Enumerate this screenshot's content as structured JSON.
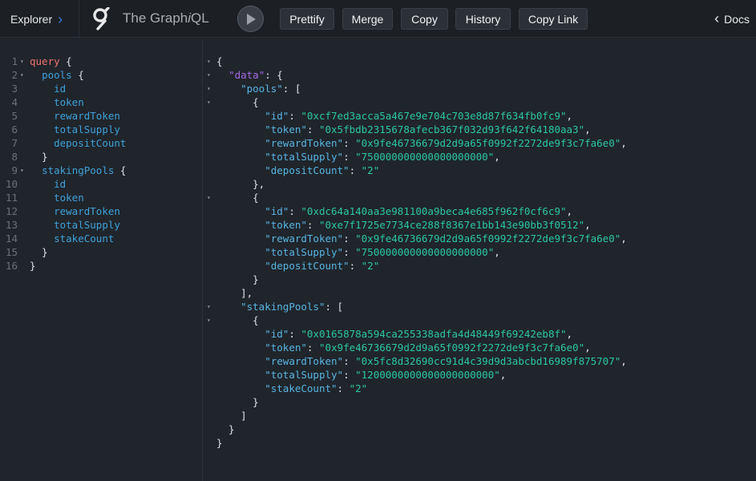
{
  "topbar": {
    "explorer_label": "Explorer",
    "title_prefix": "The Graph",
    "title_italic": "i",
    "title_suffix": "QL",
    "buttons": [
      "Prettify",
      "Merge",
      "Copy",
      "History",
      "Copy Link"
    ],
    "docs_label": "Docs"
  },
  "query_lines": [
    {
      "n": "1",
      "t": [
        [
          "kw",
          "query"
        ],
        [
          "pun",
          " {"
        ]
      ],
      "fold": true
    },
    {
      "n": "2",
      "t": [
        [
          "pun",
          "  "
        ],
        [
          "fld",
          "pools"
        ],
        [
          "pun",
          " {"
        ]
      ],
      "fold": true
    },
    {
      "n": "3",
      "t": [
        [
          "pun",
          "    "
        ],
        [
          "fld",
          "id"
        ]
      ]
    },
    {
      "n": "4",
      "t": [
        [
          "pun",
          "    "
        ],
        [
          "fld",
          "token"
        ]
      ]
    },
    {
      "n": "5",
      "t": [
        [
          "pun",
          "    "
        ],
        [
          "fld",
          "rewardToken"
        ]
      ]
    },
    {
      "n": "6",
      "t": [
        [
          "pun",
          "    "
        ],
        [
          "fld",
          "totalSupply"
        ]
      ]
    },
    {
      "n": "7",
      "t": [
        [
          "pun",
          "    "
        ],
        [
          "fld",
          "depositCount"
        ]
      ]
    },
    {
      "n": "8",
      "t": [
        [
          "pun",
          "  }"
        ]
      ]
    },
    {
      "n": "9",
      "t": [
        [
          "pun",
          "  "
        ],
        [
          "fld",
          "stakingPools"
        ],
        [
          "pun",
          " {"
        ]
      ],
      "fold": true
    },
    {
      "n": "10",
      "t": [
        [
          "pun",
          "    "
        ],
        [
          "fld",
          "id"
        ]
      ]
    },
    {
      "n": "11",
      "t": [
        [
          "pun",
          "    "
        ],
        [
          "fld",
          "token"
        ]
      ]
    },
    {
      "n": "12",
      "t": [
        [
          "pun",
          "    "
        ],
        [
          "fld",
          "rewardToken"
        ]
      ]
    },
    {
      "n": "13",
      "t": [
        [
          "pun",
          "    "
        ],
        [
          "fld",
          "totalSupply"
        ]
      ]
    },
    {
      "n": "14",
      "t": [
        [
          "pun",
          "    "
        ],
        [
          "fld",
          "stakeCount"
        ]
      ]
    },
    {
      "n": "15",
      "t": [
        [
          "pun",
          "  }"
        ]
      ]
    },
    {
      "n": "16",
      "t": [
        [
          "pun",
          "}"
        ]
      ]
    }
  ],
  "result_lines": [
    {
      "t": [
        [
          "pun",
          "{"
        ]
      ],
      "fold": true
    },
    {
      "t": [
        [
          "pun",
          "  "
        ],
        [
          "keyp",
          "\"data\""
        ],
        [
          "pun",
          ": {"
        ]
      ],
      "fold": true
    },
    {
      "t": [
        [
          "pun",
          "    "
        ],
        [
          "key",
          "\"pools\""
        ],
        [
          "pun",
          ": ["
        ]
      ],
      "fold": true
    },
    {
      "t": [
        [
          "pun",
          "      {"
        ]
      ],
      "fold": true
    },
    {
      "t": [
        [
          "pun",
          "        "
        ],
        [
          "key",
          "\"id\""
        ],
        [
          "pun",
          ": "
        ],
        [
          "str",
          "\"0xcf7ed3acca5a467e9e704c703e8d87f634fb0fc9\""
        ],
        [
          "pun",
          ","
        ]
      ]
    },
    {
      "t": [
        [
          "pun",
          "        "
        ],
        [
          "key",
          "\"token\""
        ],
        [
          "pun",
          ": "
        ],
        [
          "str",
          "\"0x5fbdb2315678afecb367f032d93f642f64180aa3\""
        ],
        [
          "pun",
          ","
        ]
      ]
    },
    {
      "t": [
        [
          "pun",
          "        "
        ],
        [
          "key",
          "\"rewardToken\""
        ],
        [
          "pun",
          ": "
        ],
        [
          "str",
          "\"0x9fe46736679d2d9a65f0992f2272de9f3c7fa6e0\""
        ],
        [
          "pun",
          ","
        ]
      ]
    },
    {
      "t": [
        [
          "pun",
          "        "
        ],
        [
          "key",
          "\"totalSupply\""
        ],
        [
          "pun",
          ": "
        ],
        [
          "str",
          "\"750000000000000000000\""
        ],
        [
          "pun",
          ","
        ]
      ]
    },
    {
      "t": [
        [
          "pun",
          "        "
        ],
        [
          "key",
          "\"depositCount\""
        ],
        [
          "pun",
          ": "
        ],
        [
          "str",
          "\"2\""
        ]
      ]
    },
    {
      "t": [
        [
          "pun",
          "      },"
        ]
      ]
    },
    {
      "t": [
        [
          "pun",
          "      {"
        ]
      ],
      "fold": true
    },
    {
      "t": [
        [
          "pun",
          "        "
        ],
        [
          "key",
          "\"id\""
        ],
        [
          "pun",
          ": "
        ],
        [
          "str",
          "\"0xdc64a140aa3e981100a9beca4e685f962f0cf6c9\""
        ],
        [
          "pun",
          ","
        ]
      ]
    },
    {
      "t": [
        [
          "pun",
          "        "
        ],
        [
          "key",
          "\"token\""
        ],
        [
          "pun",
          ": "
        ],
        [
          "str",
          "\"0xe7f1725e7734ce288f8367e1bb143e90bb3f0512\""
        ],
        [
          "pun",
          ","
        ]
      ]
    },
    {
      "t": [
        [
          "pun",
          "        "
        ],
        [
          "key",
          "\"rewardToken\""
        ],
        [
          "pun",
          ": "
        ],
        [
          "str",
          "\"0x9fe46736679d2d9a65f0992f2272de9f3c7fa6e0\""
        ],
        [
          "pun",
          ","
        ]
      ]
    },
    {
      "t": [
        [
          "pun",
          "        "
        ],
        [
          "key",
          "\"totalSupply\""
        ],
        [
          "pun",
          ": "
        ],
        [
          "str",
          "\"750000000000000000000\""
        ],
        [
          "pun",
          ","
        ]
      ]
    },
    {
      "t": [
        [
          "pun",
          "        "
        ],
        [
          "key",
          "\"depositCount\""
        ],
        [
          "pun",
          ": "
        ],
        [
          "str",
          "\"2\""
        ]
      ]
    },
    {
      "t": [
        [
          "pun",
          "      }"
        ]
      ]
    },
    {
      "t": [
        [
          "pun",
          "    ],"
        ]
      ]
    },
    {
      "t": [
        [
          "pun",
          "    "
        ],
        [
          "key",
          "\"stakingPools\""
        ],
        [
          "pun",
          ": ["
        ]
      ],
      "fold": true
    },
    {
      "t": [
        [
          "pun",
          "      {"
        ]
      ],
      "fold": true
    },
    {
      "t": [
        [
          "pun",
          "        "
        ],
        [
          "key",
          "\"id\""
        ],
        [
          "pun",
          ": "
        ],
        [
          "str",
          "\"0x0165878a594ca255338adfa4d48449f69242eb8f\""
        ],
        [
          "pun",
          ","
        ]
      ]
    },
    {
      "t": [
        [
          "pun",
          "        "
        ],
        [
          "key",
          "\"token\""
        ],
        [
          "pun",
          ": "
        ],
        [
          "str",
          "\"0x9fe46736679d2d9a65f0992f2272de9f3c7fa6e0\""
        ],
        [
          "pun",
          ","
        ]
      ]
    },
    {
      "t": [
        [
          "pun",
          "        "
        ],
        [
          "key",
          "\"rewardToken\""
        ],
        [
          "pun",
          ": "
        ],
        [
          "str",
          "\"0x5fc8d32690cc91d4c39d9d3abcbd16989f875707\""
        ],
        [
          "pun",
          ","
        ]
      ]
    },
    {
      "t": [
        [
          "pun",
          "        "
        ],
        [
          "key",
          "\"totalSupply\""
        ],
        [
          "pun",
          ": "
        ],
        [
          "str",
          "\"1200000000000000000000\""
        ],
        [
          "pun",
          ","
        ]
      ]
    },
    {
      "t": [
        [
          "pun",
          "        "
        ],
        [
          "key",
          "\"stakeCount\""
        ],
        [
          "pun",
          ": "
        ],
        [
          "str",
          "\"2\""
        ]
      ]
    },
    {
      "t": [
        [
          "pun",
          "      }"
        ]
      ]
    },
    {
      "t": [
        [
          "pun",
          "    ]"
        ]
      ]
    },
    {
      "t": [
        [
          "pun",
          "  }"
        ]
      ]
    },
    {
      "t": [
        [
          "pun",
          "}"
        ]
      ]
    }
  ]
}
